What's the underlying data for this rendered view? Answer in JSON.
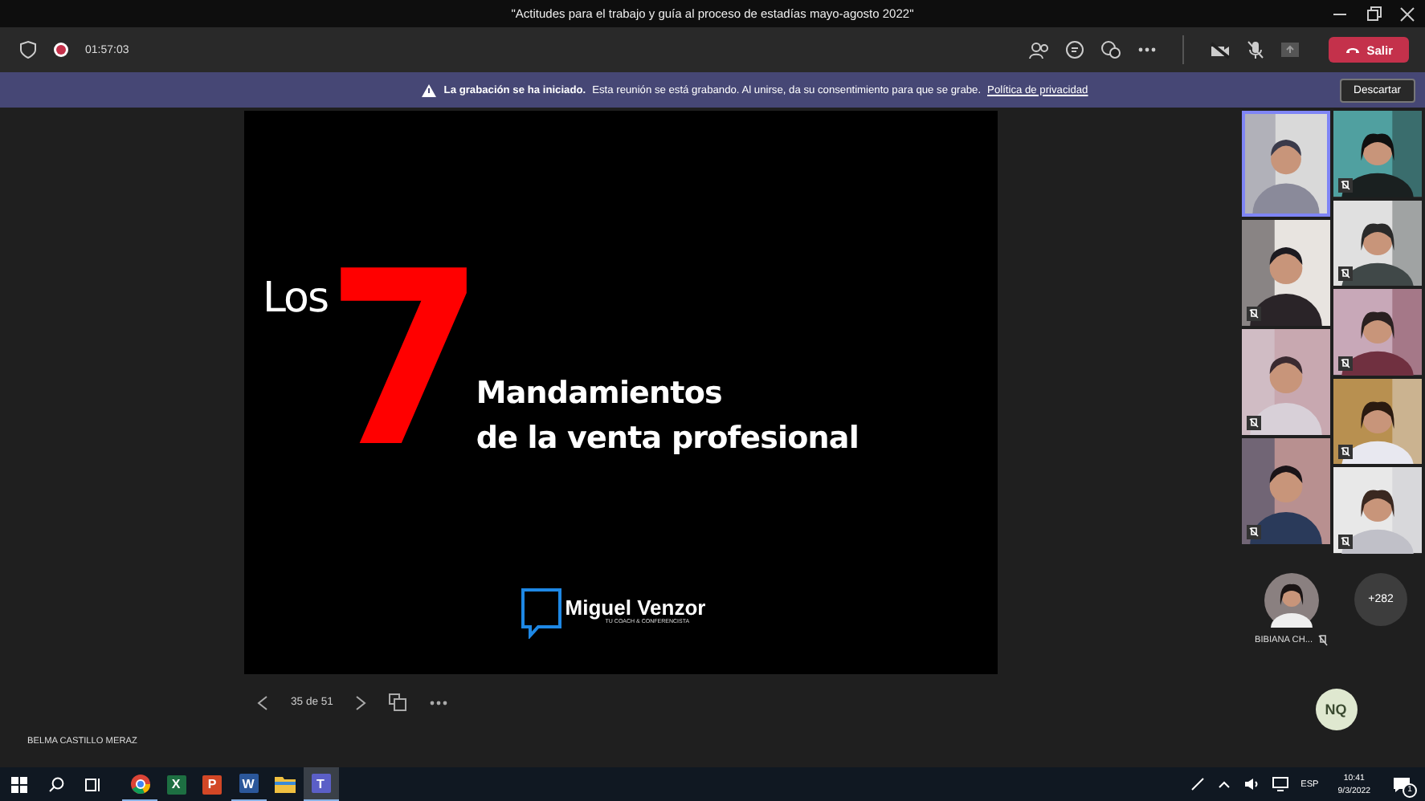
{
  "window": {
    "title": "\"Actitudes para el trabajo y guía al proceso de estadías mayo-agosto 2022\""
  },
  "toolbar": {
    "recording": true,
    "timer": "01:57:03",
    "camera_off": true,
    "mic_muted": true,
    "leave_button": "Salir"
  },
  "banner": {
    "title": "La grabación se ha iniciado.",
    "message": "Esta reunión se está grabando. Al unirse, da su consentimiento para que se grabe.",
    "link": "Política de privacidad",
    "dismiss_button": "Descartar"
  },
  "slide": {
    "prefix": "Los",
    "number": "7",
    "line_1": "Mandamientos",
    "line_2": "de la venta profesional",
    "logo_name": "Miguel Venzor",
    "logo_tagline": "TU COACH & CONFERENCISTA"
  },
  "slide_controls": {
    "counter": "35 de 51"
  },
  "presenter_name": "BELMA CASTILLO MERAZ",
  "video_tiles": {
    "left": [
      {
        "kind": "picture",
        "selected": true,
        "muted": false
      },
      {
        "kind": "picture",
        "selected": false,
        "muted": true
      },
      {
        "kind": "picture",
        "selected": false,
        "muted": true
      },
      {
        "kind": "picture",
        "selected": false,
        "muted": true
      }
    ],
    "right": [
      {
        "kind": "picture",
        "selected": false,
        "muted": true
      },
      {
        "kind": "picture",
        "selected": false,
        "muted": true
      },
      {
        "kind": "picture",
        "selected": false,
        "muted": true
      },
      {
        "kind": "picture",
        "selected": false,
        "muted": true
      },
      {
        "kind": "picture",
        "selected": false,
        "muted": true
      }
    ]
  },
  "participant": {
    "name": "BIBIANA CH...",
    "muted": true
  },
  "overflow_count": "+282",
  "self_avatar": "NQ",
  "taskbar": {
    "apps": [
      {
        "kind": "chrome",
        "running": true,
        "selected": false
      },
      {
        "kind": "excel",
        "label": "X",
        "running": false,
        "selected": false
      },
      {
        "kind": "powerpoint",
        "label": "P",
        "running": false,
        "selected": false
      },
      {
        "kind": "word",
        "label": "W",
        "running": true,
        "selected": false
      },
      {
        "kind": "explorer",
        "running": false,
        "selected": false
      },
      {
        "kind": "teams",
        "label": "T",
        "running": true,
        "selected": true
      }
    ],
    "language": "ESP",
    "time": "10:41",
    "date": "9/3/2022",
    "notifications": "1"
  }
}
